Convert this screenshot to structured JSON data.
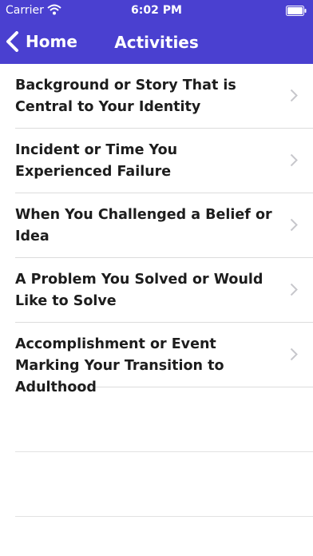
{
  "status_bar": {
    "carrier": "Carrier",
    "time": "6:02 PM"
  },
  "nav": {
    "back_label": "Home",
    "title": "Activities"
  },
  "colors": {
    "header_bg": "#4a40d0",
    "header_text": "#ffffff",
    "row_text": "#1d1d1d",
    "separator": "#dcdcdc",
    "chevron": "#c7c7cc"
  },
  "icons": {
    "wifi": "wifi-icon",
    "battery": "battery-icon",
    "back": "chevron-left-icon",
    "row": "chevron-right-icon"
  },
  "activities": [
    {
      "label": "Background or Story That is Central to Your Identity"
    },
    {
      "label": "Incident or Time You Experienced Failure"
    },
    {
      "label": "When You Challenged a Belief or Idea"
    },
    {
      "label": "A Problem You Solved or Would Like to Solve"
    },
    {
      "label": "Accomplishment or Event Marking Your Transition to Adulthood"
    }
  ]
}
